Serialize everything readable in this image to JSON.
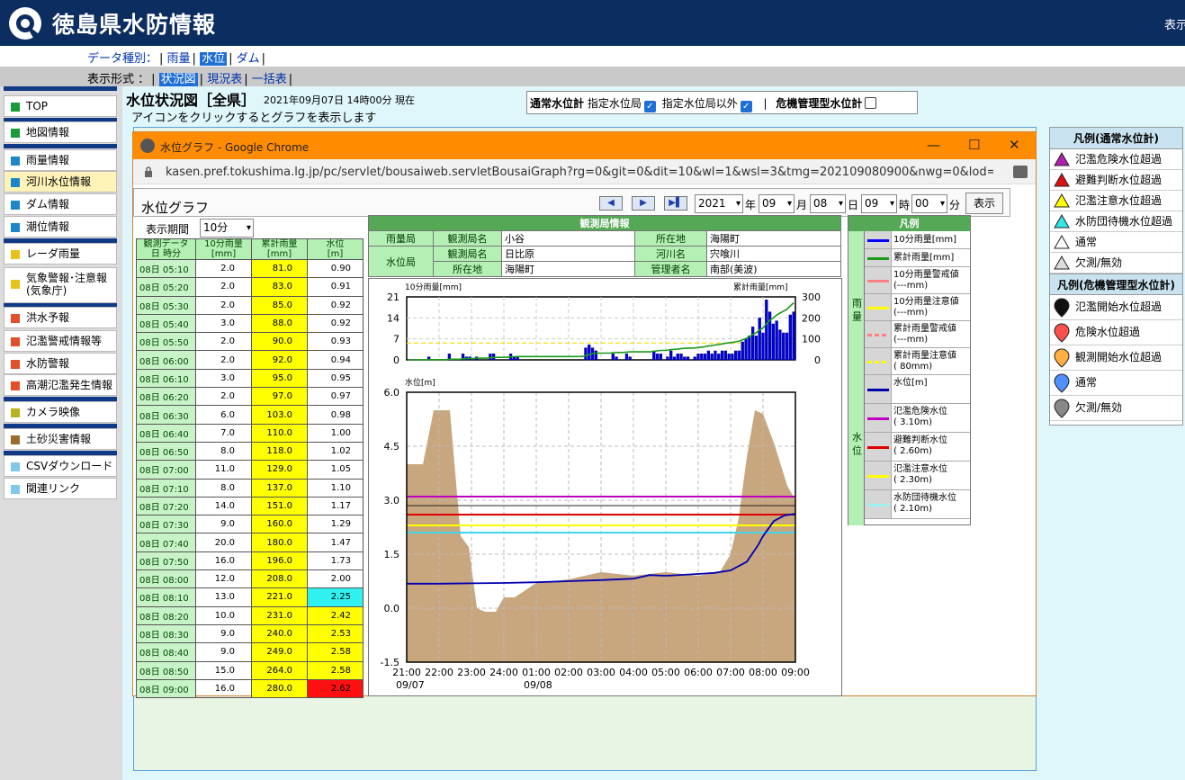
{
  "header": {
    "title": "徳島県水防情報",
    "right_text": "表示"
  },
  "nav": {
    "data_type_label": "データ種別：",
    "data_types": [
      "雨量",
      "水位",
      "ダム"
    ],
    "display_label": "表示形式 ：",
    "display_types": [
      "状況図",
      "現況表",
      "一括表"
    ]
  },
  "sidebar": {
    "items": [
      {
        "label": "TOP",
        "color": "#1a9a3a"
      },
      {
        "label": "地図情報",
        "color": "#1a9a3a"
      },
      {
        "label": "雨量情報",
        "color": "#1c86c8"
      },
      {
        "label": "河川水位情報",
        "color": "#1c86c8"
      },
      {
        "label": "ダム情報",
        "color": "#1c86c8"
      },
      {
        "label": "潮位情報",
        "color": "#1c86c8"
      },
      {
        "label": "レーダ雨量",
        "color": "#e7c21b"
      },
      {
        "label": "気象警報･注意報",
        "label2": "(気象庁)",
        "color": "#e7c21b"
      },
      {
        "label": "洪水予報",
        "color": "#e0512b"
      },
      {
        "label": "氾濫警戒情報等",
        "color": "#e0512b"
      },
      {
        "label": "水防警報",
        "color": "#e0512b"
      },
      {
        "label": "高潮氾濫発生情報",
        "color": "#e0512b"
      },
      {
        "label": "カメラ映像",
        "color": "#b9b21e"
      },
      {
        "label": "土砂災害情報",
        "color": "#9a6b2a"
      },
      {
        "label": "CSVダウンロード",
        "color": "#7fc8e8"
      },
      {
        "label": "関連リンク",
        "color": "#7fc8e8"
      }
    ]
  },
  "page": {
    "title": "水位状況図［全県］",
    "timestamp": "2021年09月07日 14時00分 現在",
    "hint": "アイコンをクリックするとグラフを表示します"
  },
  "filter": {
    "normal_label": "通常水位計",
    "designated_label": "指定水位局",
    "non_designated_label": "指定水位局以外",
    "separator": "|",
    "crisis_label": "危機管理型水位計"
  },
  "legend_normal": {
    "title": "凡例(通常水位計)",
    "items": [
      {
        "label": "氾濫危険水位超過",
        "color": "#b01fb0"
      },
      {
        "label": "避難判断水位超過",
        "color": "#e01010"
      },
      {
        "label": "氾濫注意水位超過",
        "color": "#ffff00"
      },
      {
        "label": "水防団待機水位超過",
        "color": "#30e8e8"
      },
      {
        "label": "通常",
        "color": "#ffffff"
      },
      {
        "label": "欠測/無効",
        "color": "#dddddd"
      }
    ]
  },
  "legend_crisis": {
    "title": "凡例(危機管理型水位計)",
    "items": [
      {
        "label": "氾濫開始水位超過",
        "color": "#111111"
      },
      {
        "label": "危険水位超過",
        "color": "#ff5050"
      },
      {
        "label": "観測開始水位超過",
        "color": "#ffb040"
      },
      {
        "label": "通常",
        "color": "#5090ff"
      },
      {
        "label": "欠測/無効",
        "color": "#888888"
      }
    ]
  },
  "window": {
    "title": "水位グラフ - Google Chrome",
    "url": "kasen.pref.tokushima.lg.jp/pc/servlet/bousaiweb.servletBousaiGraph?rg=0&git=0&dit=10&wl=1&wsl=3&tmg=202109080900&nwg=0&lod=0&sv=..."
  },
  "graph_page": {
    "title": "水位グラフ",
    "nav_prev": "◀",
    "nav_next": "▶",
    "nav_last": "▶▌",
    "year": "2021",
    "year_unit": "年",
    "month": "09",
    "month_unit": "月",
    "day": "08",
    "day_unit": "日",
    "hour": "09",
    "hour_unit": "時",
    "minute": "00",
    "minute_unit": "分",
    "show_button": "表示",
    "period_label": "表示期間",
    "period_value": "10分"
  },
  "table": {
    "h_time_1": "観測データ",
    "h_time_2": "日 時分",
    "h_rain10": "10分雨量",
    "h_rain10_unit": "[mm]",
    "h_cum": "累計雨量",
    "h_cum_unit": "[mm]",
    "h_level": "水位",
    "h_level_unit": "[m]",
    "rows": [
      {
        "t": "08日 05:10",
        "r": "2.0",
        "c": "81.0",
        "w": "0.90",
        "wc": "#ffffff"
      },
      {
        "t": "08日 05:20",
        "r": "2.0",
        "c": "83.0",
        "w": "0.91",
        "wc": "#ffffff"
      },
      {
        "t": "08日 05:30",
        "r": "2.0",
        "c": "85.0",
        "w": "0.92",
        "wc": "#ffffff"
      },
      {
        "t": "08日 05:40",
        "r": "3.0",
        "c": "88.0",
        "w": "0.92",
        "wc": "#ffffff"
      },
      {
        "t": "08日 05:50",
        "r": "2.0",
        "c": "90.0",
        "w": "0.93",
        "wc": "#ffffff"
      },
      {
        "t": "08日 06:00",
        "r": "2.0",
        "c": "92.0",
        "w": "0.94",
        "wc": "#ffffff"
      },
      {
        "t": "08日 06:10",
        "r": "3.0",
        "c": "95.0",
        "w": "0.95",
        "wc": "#ffffff"
      },
      {
        "t": "08日 06:20",
        "r": "2.0",
        "c": "97.0",
        "w": "0.97",
        "wc": "#ffffff"
      },
      {
        "t": "08日 06:30",
        "r": "6.0",
        "c": "103.0",
        "w": "0.98",
        "wc": "#ffffff"
      },
      {
        "t": "08日 06:40",
        "r": "7.0",
        "c": "110.0",
        "w": "1.00",
        "wc": "#ffffff"
      },
      {
        "t": "08日 06:50",
        "r": "8.0",
        "c": "118.0",
        "w": "1.02",
        "wc": "#ffffff"
      },
      {
        "t": "08日 07:00",
        "r": "11.0",
        "c": "129.0",
        "w": "1.05",
        "wc": "#ffffff"
      },
      {
        "t": "08日 07:10",
        "r": "8.0",
        "c": "137.0",
        "w": "1.10",
        "wc": "#ffffff"
      },
      {
        "t": "08日 07:20",
        "r": "14.0",
        "c": "151.0",
        "w": "1.17",
        "wc": "#ffffff"
      },
      {
        "t": "08日 07:30",
        "r": "9.0",
        "c": "160.0",
        "w": "1.29",
        "wc": "#ffffff"
      },
      {
        "t": "08日 07:40",
        "r": "20.0",
        "c": "180.0",
        "w": "1.47",
        "wc": "#ffffff"
      },
      {
        "t": "08日 07:50",
        "r": "16.0",
        "c": "196.0",
        "w": "1.73",
        "wc": "#ffffff"
      },
      {
        "t": "08日 08:00",
        "r": "12.0",
        "c": "208.0",
        "w": "2.00",
        "wc": "#ffffff"
      },
      {
        "t": "08日 08:10",
        "r": "13.0",
        "c": "221.0",
        "w": "2.25",
        "wc": "#30f0f0"
      },
      {
        "t": "08日 08:20",
        "r": "10.0",
        "c": "231.0",
        "w": "2.42",
        "wc": "#ffff00"
      },
      {
        "t": "08日 08:30",
        "r": "9.0",
        "c": "240.0",
        "w": "2.53",
        "wc": "#ffff00"
      },
      {
        "t": "08日 08:40",
        "r": "9.0",
        "c": "249.0",
        "w": "2.58",
        "wc": "#ffff00"
      },
      {
        "t": "08日 08:50",
        "r": "15.0",
        "c": "264.0",
        "w": "2.58",
        "wc": "#ffff00"
      },
      {
        "t": "08日 09:00",
        "r": "16.0",
        "c": "280.0",
        "w": "2.62",
        "wc": "#ff1010"
      }
    ]
  },
  "station": {
    "header": "観測局情報",
    "rain_label": "雨量局",
    "name_label": "観測局名",
    "rain_name": "小谷",
    "loc_label": "所在地",
    "rain_loc": "海陽町",
    "water_label": "水位局",
    "water_name": "日比原",
    "river_label": "河川名",
    "river": "宍喰川",
    "water_loc": "海陽町",
    "admin_label": "管理者名",
    "admin": "南部(美波)"
  },
  "legend_graph": {
    "title": "凡例",
    "rain_side": "雨量",
    "water_side": "水位",
    "rows": [
      {
        "label": "10分雨量[mm]",
        "color": "#0000ff",
        "style": "solid"
      },
      {
        "label": "累計雨量[mm]",
        "color": "#1a9a1a",
        "style": "solid"
      },
      {
        "label": "10分雨量警戒値",
        "label2": "(---mm)",
        "color": "#ff8080",
        "style": "solid"
      },
      {
        "label": "10分雨量注意値",
        "label2": "(---mm)",
        "color": "#ffff00",
        "style": "solid"
      },
      {
        "label": "累計雨量警戒値",
        "label2": "(---mm)",
        "color": "#ff8080",
        "style": "dash"
      },
      {
        "label": "累計雨量注意値",
        "label2": "(  80mm)",
        "color": "#ffff00",
        "style": "dash"
      },
      {
        "label": "水位[m]",
        "color": "#0000aa",
        "style": "solid"
      },
      {
        "label": "氾濫危険水位",
        "label2": "(    3.10m)",
        "color": "#c000c0",
        "style": "solid"
      },
      {
        "label": "避難判断水位",
        "label2": "(    2.60m)",
        "color": "#e00000",
        "style": "solid"
      },
      {
        "label": "氾濫注意水位",
        "label2": "(    2.30m)",
        "color": "#ffff00",
        "style": "solid"
      },
      {
        "label": "水防団待機水位",
        "label2": "(    2.10m)",
        "color": "#a0f0f0",
        "style": "solid"
      }
    ]
  },
  "chart_data": [
    {
      "type": "bar",
      "title": "",
      "ylabel": "10分雨量[mm]",
      "y2label": "累計雨量[mm]",
      "ylim": [
        0,
        21
      ],
      "y2lim": [
        0,
        300
      ],
      "yticks": [
        "21",
        "14",
        "7",
        "0"
      ],
      "y2ticks": [
        "300",
        "200",
        "100",
        "0"
      ],
      "x_start": "09/07 21:00",
      "interval_min": 10,
      "values": [
        0,
        0,
        0,
        0,
        0,
        0,
        1,
        0,
        0,
        0,
        0,
        0,
        2,
        0,
        0,
        0,
        2,
        1,
        1,
        0,
        1,
        0,
        0,
        0,
        2,
        2,
        0,
        0,
        0,
        0,
        2,
        1,
        1,
        0,
        0,
        0,
        0,
        0,
        0,
        0,
        0,
        0,
        0,
        0,
        0,
        0,
        0,
        0,
        0,
        0,
        0,
        0,
        4,
        5,
        4,
        3,
        0,
        0,
        0,
        0,
        2,
        1,
        0,
        0,
        2,
        1,
        0,
        0,
        0,
        0,
        0,
        0,
        3,
        2,
        2,
        0,
        1,
        3,
        1,
        2,
        2,
        1,
        1,
        0,
        1,
        2,
        2,
        2,
        3,
        2,
        3,
        2,
        3,
        3,
        2,
        2,
        3,
        3,
        6,
        7,
        8,
        11,
        8,
        14,
        9,
        20,
        16,
        12,
        13,
        10,
        9,
        9,
        15,
        16
      ],
      "cumulative": [
        0,
        0,
        0,
        0,
        0,
        0,
        1,
        1,
        1,
        1,
        1,
        1,
        3,
        3,
        3,
        3,
        5,
        6,
        7,
        7,
        8,
        8,
        8,
        8,
        10,
        12,
        12,
        12,
        12,
        12,
        14,
        15,
        16,
        16,
        16,
        16,
        16,
        16,
        16,
        16,
        16,
        16,
        16,
        16,
        16,
        16,
        16,
        16,
        16,
        16,
        16,
        16,
        20,
        25,
        29,
        32,
        32,
        32,
        32,
        32,
        34,
        35,
        35,
        35,
        37,
        38,
        38,
        38,
        38,
        38,
        38,
        38,
        41,
        43,
        45,
        45,
        46,
        49,
        50,
        52,
        54,
        55,
        56,
        56,
        57,
        59,
        61,
        63,
        66,
        68,
        71,
        73,
        76,
        79,
        81,
        83,
        86,
        89,
        95,
        102,
        110,
        121,
        129,
        143,
        152,
        172,
        188,
        200,
        213,
        223,
        232,
        241,
        256,
        272
      ],
      "thresholds": [
        {
          "name": "累計雨量注意値",
          "value": 80,
          "axis": "y2"
        }
      ]
    },
    {
      "type": "line",
      "title": "",
      "ylabel": "水位[m]",
      "ylim": [
        -1.5,
        6.0
      ],
      "yticks": [
        "6.0",
        "4.5",
        "3.0",
        "1.5",
        "0.0",
        "-1.5"
      ],
      "xticks": [
        "21:00",
        "22:00",
        "23:00",
        "24:00",
        "01:00",
        "02:00",
        "03:00",
        "04:00",
        "05:00",
        "06:00",
        "07:00",
        "08:00",
        "09:00"
      ],
      "xdates": [
        "09/07",
        "09/08"
      ],
      "series": [
        {
          "name": "水位[m]",
          "x": [
            "21:00",
            "22:00",
            "23:00",
            "24:00",
            "01:00",
            "02:00",
            "03:00",
            "04:00",
            "04:30",
            "05:00",
            "06:00",
            "06:30",
            "07:00",
            "07:30",
            "07:50",
            "08:00",
            "08:20",
            "08:40",
            "09:00"
          ],
          "values": [
            0.68,
            0.68,
            0.69,
            0.7,
            0.72,
            0.75,
            0.78,
            0.82,
            0.92,
            0.9,
            0.95,
            0.98,
            1.05,
            1.29,
            1.73,
            2.0,
            2.42,
            2.58,
            2.62
          ]
        }
      ],
      "thresholds": [
        {
          "name": "氾濫危険水位",
          "value": 3.1,
          "color": "#c000c0"
        },
        {
          "name": "避難判断水位",
          "value": 2.6,
          "color": "#e00000"
        },
        {
          "name": "氾濫注意水位",
          "value": 2.3,
          "color": "#ffff00"
        },
        {
          "name": "水防団待機水位",
          "value": 2.1,
          "color": "#40d8e8"
        }
      ],
      "section": {
        "x": [
          "21:00",
          "21:30",
          "21:50",
          "22:20",
          "22:40",
          "22:55",
          "23:10",
          "23:25",
          "23:45",
          "24:00",
          "24:20",
          "24:40",
          "01:00",
          "02:00",
          "03:00",
          "04:00",
          "05:00",
          "06:00",
          "06:40",
          "07:00",
          "07:15",
          "07:30",
          "07:45",
          "08:00",
          "08:20",
          "08:45",
          "09:00"
        ],
        "y": [
          4.0,
          4.0,
          5.5,
          5.5,
          2.0,
          1.7,
          0.0,
          -0.1,
          -0.1,
          0.3,
          0.3,
          0.5,
          0.7,
          0.8,
          1.0,
          0.9,
          1.0,
          0.9,
          1.0,
          1.5,
          2.5,
          4.2,
          5.5,
          5.4,
          4.6,
          3.4,
          3.0
        ]
      }
    }
  ]
}
